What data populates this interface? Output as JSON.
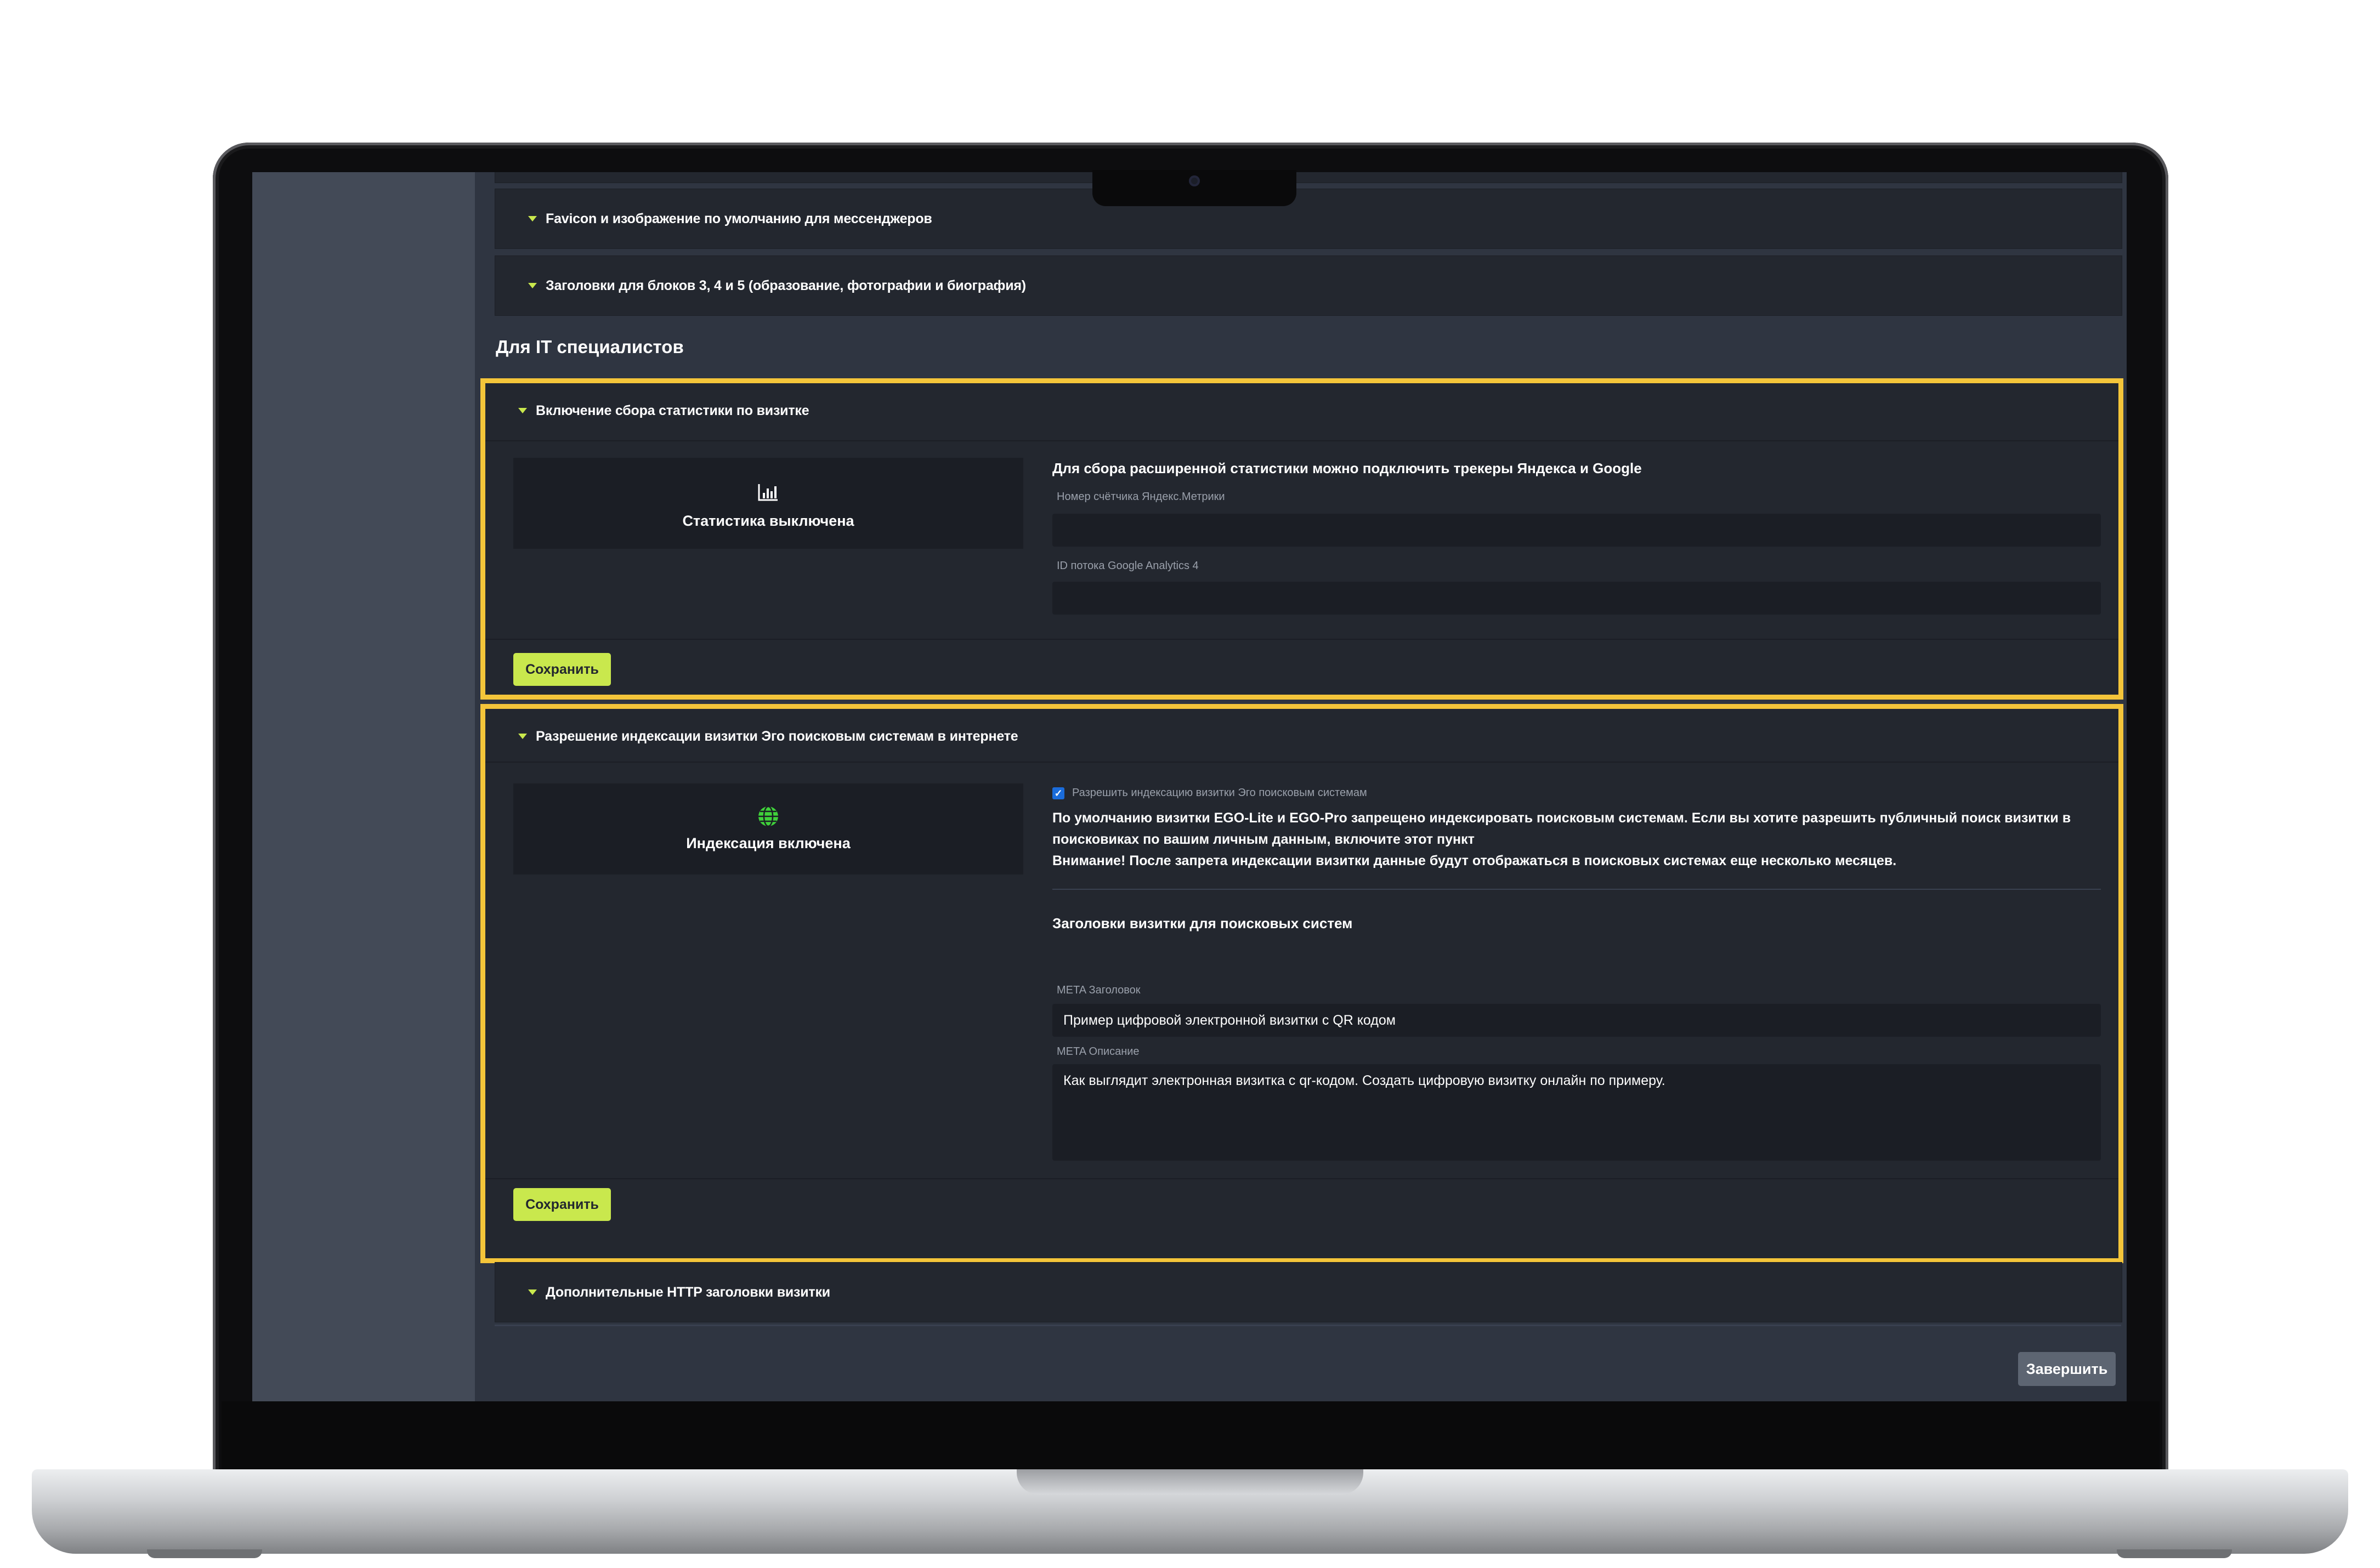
{
  "accordions": {
    "favicon": "Favicon и изображение по умолчанию для мессенджеров",
    "headers_blocks": "Заголовки для блоков 3, 4 и 5 (образование, фотографии и биография)",
    "http_headers": "Дополнительные HTTP заголовки визитки"
  },
  "section_title": "Для IT специалистов",
  "stats": {
    "heading": "Включение сбора статистики по визитке",
    "status_icon": "bar-chart-icon",
    "status_label": "Статистика выключена",
    "description": "Для сбора расширенной статистики можно подключить трекеры Яндекса и Google",
    "yandex_label": "Номер счётчика Яндекс.Метрики",
    "yandex_value": "",
    "ga_label": "ID потока Google Analytics 4",
    "ga_value": "",
    "save_label": "Сохранить"
  },
  "indexing": {
    "heading": "Разрешение индексации визитки Эго поисковым системам в интернете",
    "status_icon": "globe-icon",
    "status_label": "Индексация включена",
    "checkbox_label": "Разрешить индексацию визитки Эго поисковым системам",
    "checkbox_checked": true,
    "info": "По умолчанию визитки EGO-Lite и EGO-Pro запрещено индексировать поисковым системам. Если вы хотите разрешить публичный поиск визитки в поисковиках по вашим личным данным, включите этот пункт",
    "warning": "Внимание! После запрета индексации визитки данные будут отображаться в поисковых системах еще несколько месяцев.",
    "seo_heading": "Заголовки визитки для поисковых систем",
    "meta_title_label": "META Заголовок",
    "meta_title_value": "Пример цифровой электронной визитки с QR кодом",
    "meta_desc_label": "META Описание",
    "meta_desc_value": "Как выглядит электронная визитка с qr-кодом. Создать цифровую визитку онлайн по примеру.",
    "save_label": "Сохранить"
  },
  "finish_label": "Завершить",
  "colors": {
    "accent": "#c9e84d",
    "highlight": "#f4c53a",
    "panel": "#23272f",
    "background": "#2f3541",
    "sidebar": "#434a57",
    "globe": "#3fd13a"
  }
}
